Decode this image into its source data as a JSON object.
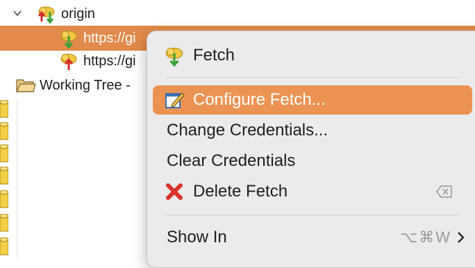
{
  "tree": {
    "remote_name": "origin",
    "fetch_url": "https://gi",
    "push_url": "https://gi",
    "working_tree_label": "Working Tree -",
    "icons": {
      "remote": "remote-repo-icon",
      "fetch": "fetch-spec-icon",
      "push": "push-spec-icon",
      "folder": "folder-icon",
      "disclosure": "chevron-down-icon",
      "repo_column": "repository-cylinder-icon"
    }
  },
  "context_menu": {
    "items": [
      {
        "label": "Fetch",
        "icon": "fetch-icon"
      },
      {
        "label": "Configure Fetch...",
        "icon": "configure-icon"
      },
      {
        "label": "Change Credentials..."
      },
      {
        "label": "Clear Credentials"
      },
      {
        "label": "Delete Fetch",
        "icon": "delete-red-x-icon",
        "shortcut_icon": "clear-key-icon"
      },
      {
        "label": "Show In",
        "shortcut": "⌥⌘W",
        "submenu_icon": "chevron-right-icon"
      }
    ]
  },
  "colors": {
    "selection": "#e18a4a",
    "menu_highlight": "#eb9353",
    "menu_background": "#ebebeb",
    "delete_red": "#d9342b"
  }
}
